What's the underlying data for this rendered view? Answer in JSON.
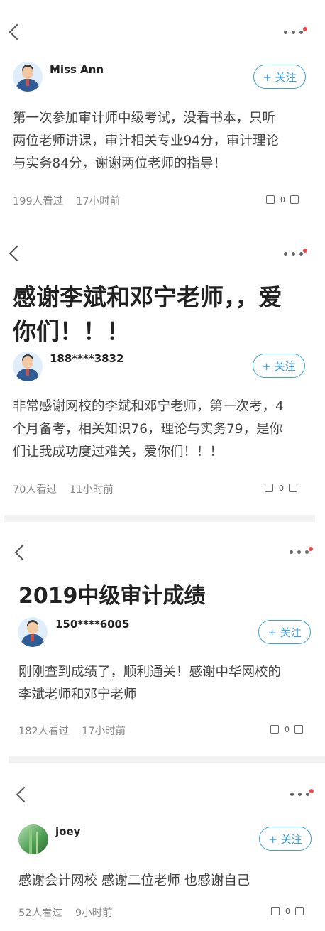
{
  "follow_label": "+ 关注",
  "posts": [
    {
      "user": "Miss Ann",
      "content_lines": [
        "第一次参加审计师中级考试，没看书本，只听",
        "两位老师讲课，审计相关专业94分，审计理论",
        "与实务84分，谢谢两位老师的指导！"
      ],
      "views": "199人看过",
      "time": "17小时前",
      "likes": "0"
    },
    {
      "title_lines": [
        "感谢李斌和邓宁老师，，爱",
        "你们！！！"
      ],
      "user": "188****3832",
      "content_lines": [
        "非常感谢网校的李斌和邓宁老师，第一次考，4",
        "个月备考，相关知识76，理论与实务79，是你",
        "们让我成功度过难关，爱你们！！！"
      ],
      "views": "70人看过",
      "time": "11小时前",
      "likes": "0"
    },
    {
      "title_lines": [
        "2019中级审计成绩"
      ],
      "user": "150****6005",
      "content_lines": [
        "刚刚查到成绩了，顺利通关！感谢中华网校的",
        "李斌老师和邓宁老师"
      ],
      "views": "182人看过",
      "time": "17小时前",
      "likes": "0"
    },
    {
      "user": "joey",
      "content_lines": [
        "感谢会计网校  感谢二位老师  也感谢自己"
      ],
      "views": "52人看过",
      "time": "9小时前",
      "likes": "0"
    }
  ]
}
